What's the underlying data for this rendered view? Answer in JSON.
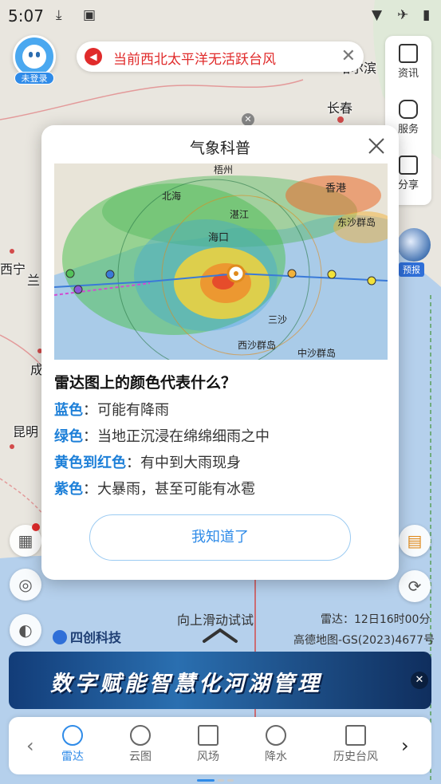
{
  "status_bar": {
    "time": "5:07"
  },
  "user": {
    "login_badge": "未登录"
  },
  "alert": {
    "text": "当前西北太平洋无活跃台风"
  },
  "right_tools": [
    {
      "label": "资讯",
      "icon": "news-icon"
    },
    {
      "label": "服务",
      "icon": "service-icon"
    },
    {
      "label": "分享",
      "icon": "share-icon"
    }
  ],
  "forecast_badge": {
    "label": "预报"
  },
  "map_labels": {
    "harbin": "哈尔滨",
    "changchun": "长春",
    "xining": "西宁",
    "lan": "兰",
    "cheng": "成",
    "kunming": "昆明"
  },
  "modal": {
    "title": "气象科普",
    "radar_labels": {
      "haikou": "海口",
      "beihai": "北海",
      "xianggang": "香港",
      "zhanjiang": "湛江",
      "dongsha": "东沙群岛",
      "xisha": "西沙群岛",
      "zhongsha": "中沙群岛",
      "wuzhou": "梧州",
      "sansha": "三沙"
    },
    "question": "雷达图上的颜色代表什么？",
    "legend": [
      {
        "key": "蓝色",
        "desc": "：可能有降雨"
      },
      {
        "key": "绿色",
        "desc": "：当地正沉浸在绵绵细雨之中"
      },
      {
        "key": "黄色到红色",
        "desc": "：有中到大雨现身"
      },
      {
        "key": "紫色",
        "desc": "：大暴雨，甚至可能有冰雹"
      }
    ],
    "ok_button": "我知道了"
  },
  "bottom_info": {
    "swipe_hint": "向上滑动试试",
    "radar_time": "雷达：12日16时00分",
    "map_credit": "高德地图-GS(2023)4677号",
    "brand": "四创科技"
  },
  "ad": {
    "text": "数字赋能智慧化河湖管理"
  },
  "bottom_nav": [
    {
      "label": "雷达",
      "icon": "radar-icon",
      "active": true
    },
    {
      "label": "云图",
      "icon": "satellite-icon",
      "active": false
    },
    {
      "label": "风场",
      "icon": "wind-icon",
      "active": false
    },
    {
      "label": "降水",
      "icon": "rain-icon",
      "active": false
    },
    {
      "label": "历史台风",
      "icon": "history-icon",
      "active": false
    }
  ]
}
